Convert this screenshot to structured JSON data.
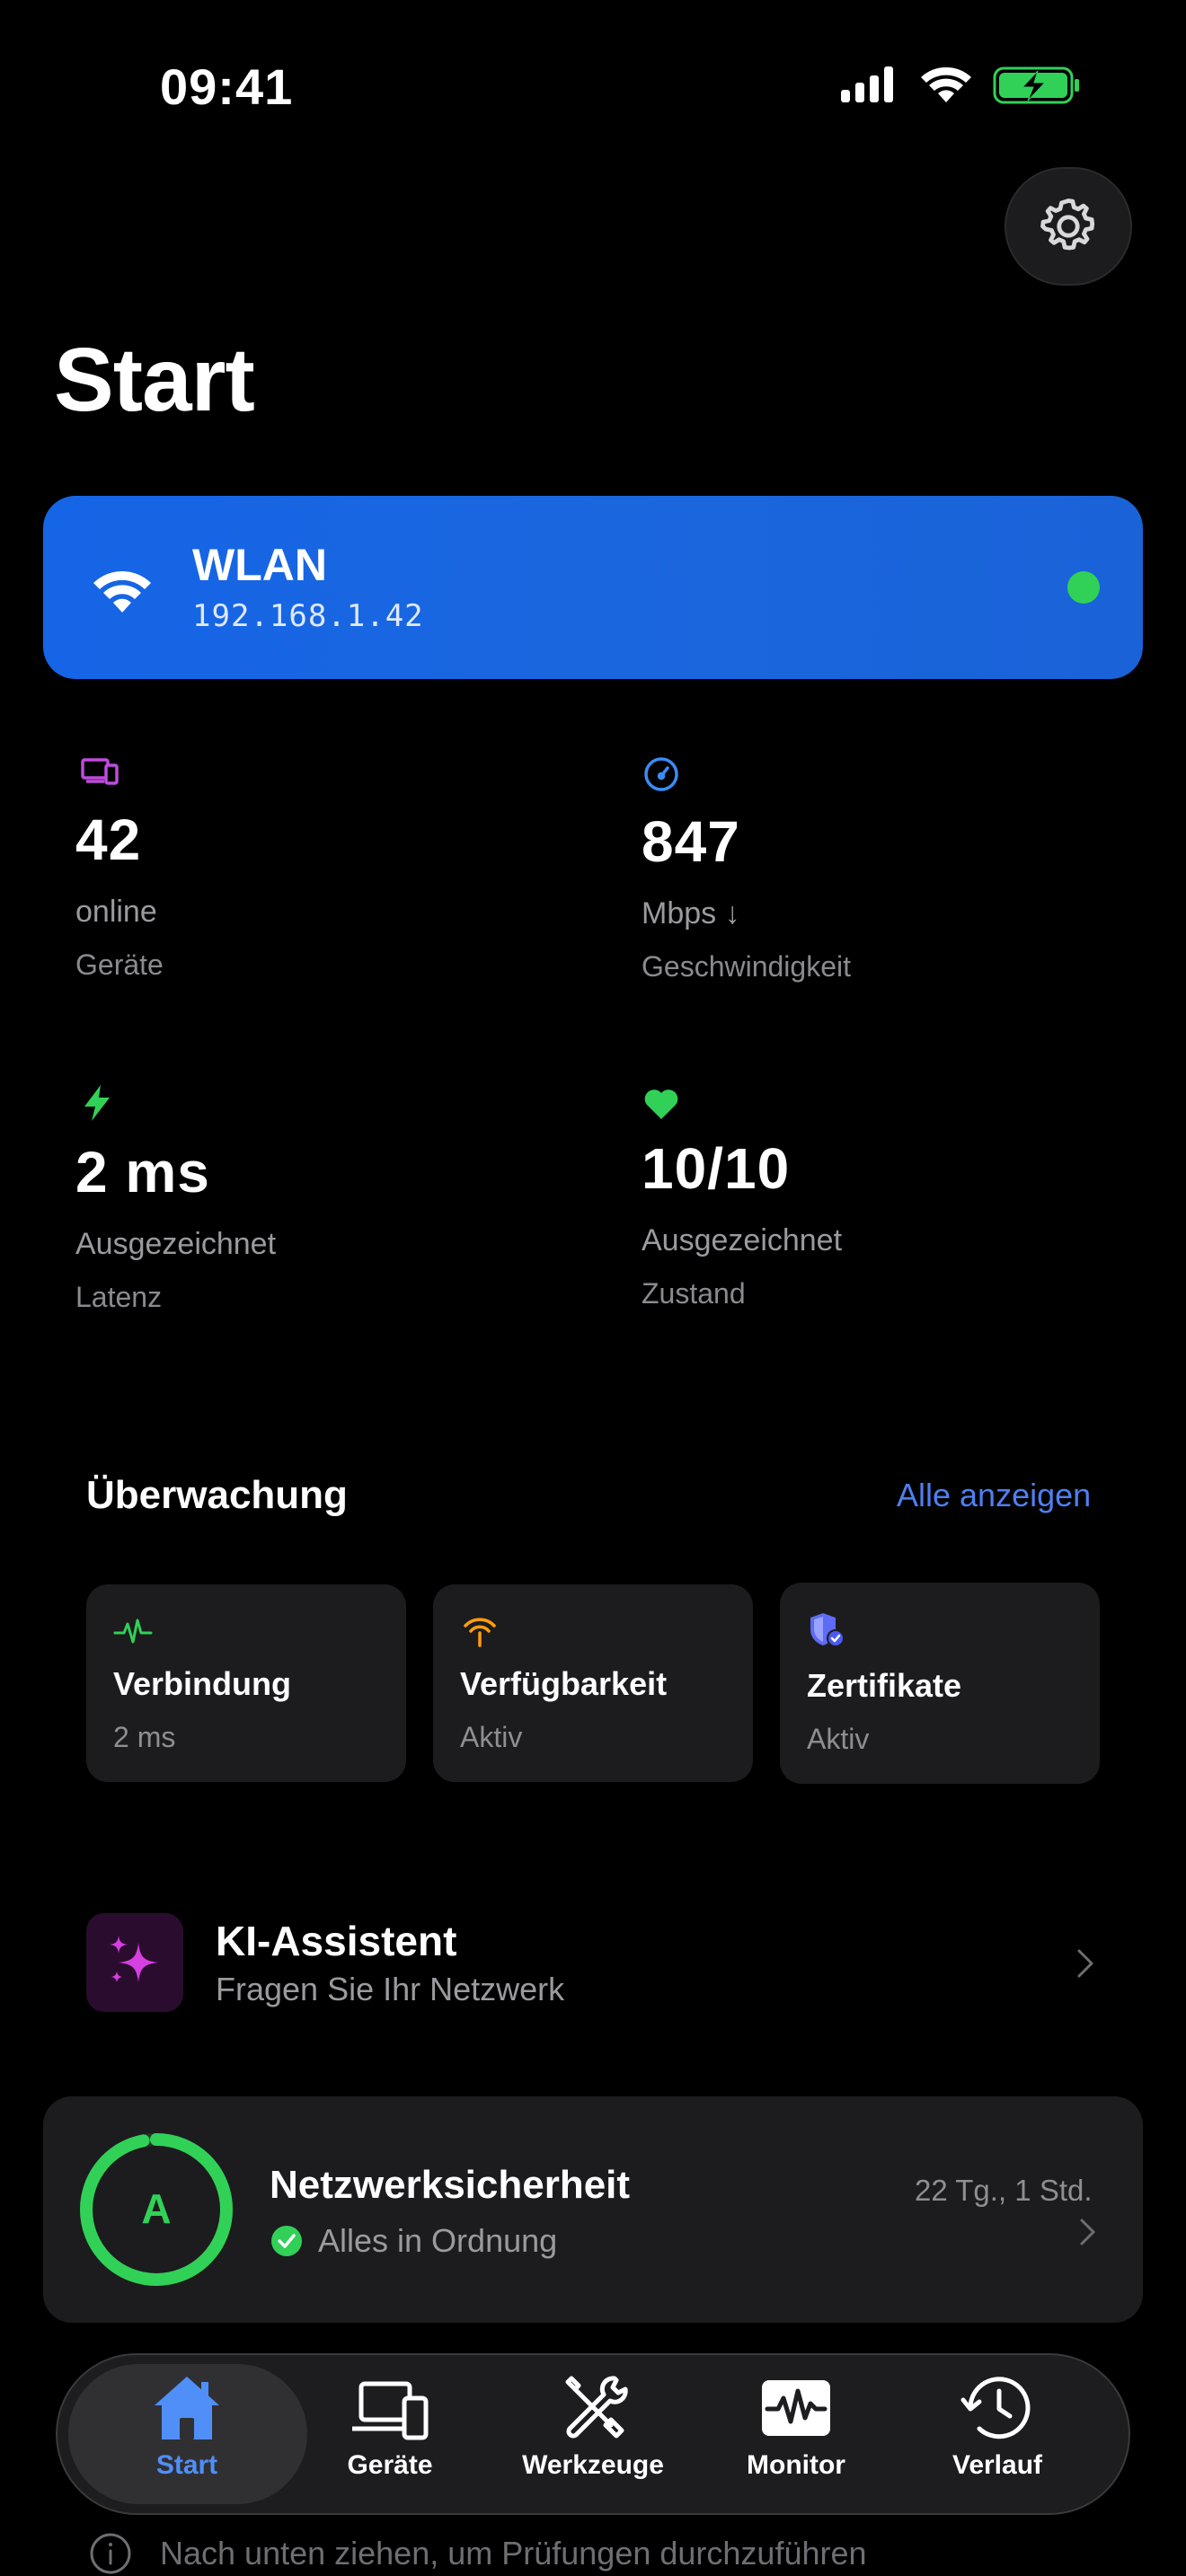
{
  "status_bar": {
    "time": "09:41"
  },
  "header": {
    "title": "Start"
  },
  "wlan": {
    "title": "WLAN",
    "ip": "192.168.1.42",
    "status_color": "#31d158"
  },
  "stats": [
    {
      "icon": "devices-icon",
      "value": "42",
      "sub": "online",
      "label": "Geräte",
      "color": "#c04be0"
    },
    {
      "icon": "speedometer-icon",
      "value": "847",
      "sub": "Mbps ↓",
      "label": "Geschwindigkeit",
      "color": "#3a8cf5"
    },
    {
      "icon": "bolt-icon",
      "value": "2 ms",
      "sub": "Ausgezeichnet",
      "label": "Latenz",
      "color": "#31d158"
    },
    {
      "icon": "heart-icon",
      "value": "10/10",
      "sub": "Ausgezeichnet",
      "label": "Zustand",
      "color": "#31d158"
    }
  ],
  "monitoring": {
    "title": "Überwachung",
    "link": "Alle anzeigen",
    "cards": [
      {
        "icon": "pulse-icon",
        "title": "Verbindung",
        "sub": "2 ms",
        "color": "#31d158"
      },
      {
        "icon": "broadcast-icon",
        "title": "Verfügbarkeit",
        "sub": "Aktiv",
        "color": "#ff9f0a"
      },
      {
        "icon": "shield-check-icon",
        "title": "Zertifikate",
        "sub": "Aktiv",
        "color": "#5e6cf5"
      }
    ]
  },
  "ai": {
    "title": "KI-Assistent",
    "subtitle": "Fragen Sie Ihr Netzwerk",
    "color": "#d63fe0"
  },
  "security": {
    "grade": "A",
    "title": "Netzwerksicherheit",
    "status": "Alles in Ordnung",
    "time": "22 Tg., 1 Std.",
    "score_fraction": 0.97,
    "color": "#31d158"
  },
  "hint": {
    "text": "Nach unten ziehen, um Prüfungen durchzuführen"
  },
  "tabs": [
    {
      "label": "Start",
      "icon": "house-icon",
      "active": true
    },
    {
      "label": "Geräte",
      "icon": "laptop-phone-icon",
      "active": false
    },
    {
      "label": "Werkzeuge",
      "icon": "tools-icon",
      "active": false
    },
    {
      "label": "Monitor",
      "icon": "waveform-monitor-icon",
      "active": false
    },
    {
      "label": "Verlauf",
      "icon": "history-icon",
      "active": false
    }
  ]
}
